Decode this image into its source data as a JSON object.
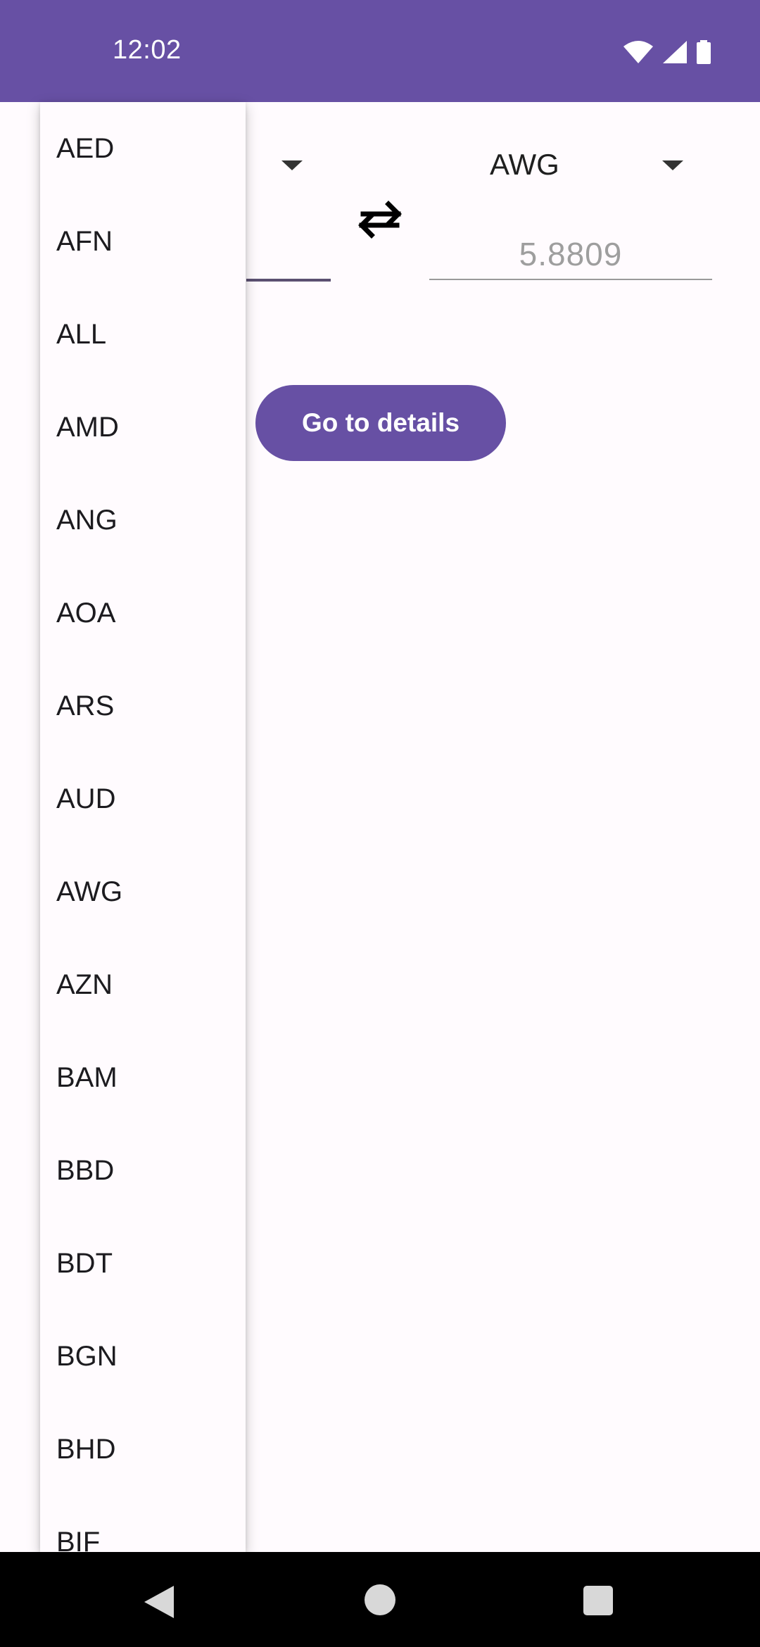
{
  "status_bar": {
    "time": "12:02",
    "icons": [
      "wifi-icon",
      "signal-icon",
      "battery-icon"
    ],
    "background": "#6750a4"
  },
  "converter": {
    "to_currency": "AWG",
    "result_value": "5.8809",
    "swap_icon": "swap-arrows-icon",
    "details_button_label": "Go to details"
  },
  "dropdown": {
    "items": [
      "AED",
      "AFN",
      "ALL",
      "AMD",
      "ANG",
      "AOA",
      "ARS",
      "AUD",
      "AWG",
      "AZN",
      "BAM",
      "BBD",
      "BDT",
      "BGN",
      "BHD",
      "BIF"
    ]
  },
  "nav_bar": {
    "icons": [
      "back-icon",
      "home-icon",
      "recents-icon"
    ]
  },
  "colors": {
    "accent": "#6750a4",
    "background": "#fffbfe"
  }
}
